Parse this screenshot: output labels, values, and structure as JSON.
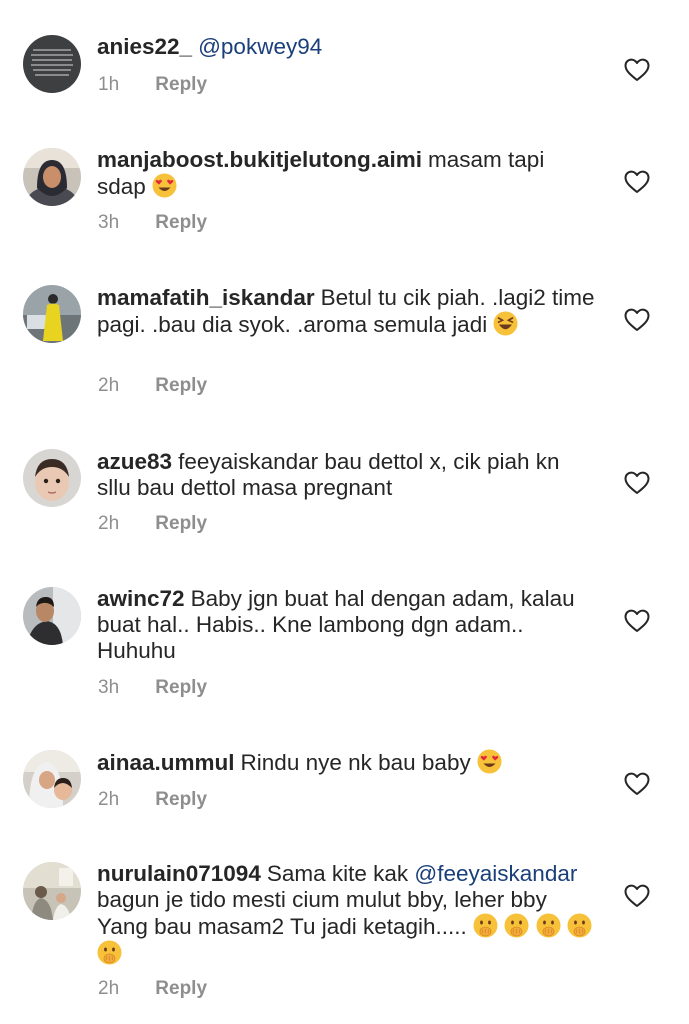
{
  "comments": [
    {
      "username": "anies22_",
      "text": "@pokwey94",
      "time": "1h",
      "reply_label": "Reply",
      "avatar_icon": "dark-text-image-avatar",
      "like_icon": "heart-outline-icon"
    },
    {
      "username": "manjaboost.bukitjelutong.aimi",
      "text": "masam tapi sdap",
      "emoji": "heart-eyes-emoji",
      "time": "3h",
      "reply_label": "Reply",
      "avatar_icon": "woman-hijab-avatar",
      "like_icon": "heart-outline-icon"
    },
    {
      "username": "mamafatih_iskandar",
      "text": "Betul tu cik piah. .lagi2 time pagi. .bau dia syok. .aroma semula jadi",
      "emoji": "laughing-squint-emoji",
      "time": "2h",
      "reply_label": "Reply",
      "avatar_icon": "woman-yellow-dress-avatar",
      "like_icon": "heart-outline-icon"
    },
    {
      "username": "azue83",
      "text": "feeyaiskandar bau dettol x, cik piah kn sllu bau dettol masa pregnant",
      "time": "2h",
      "reply_label": "Reply",
      "avatar_icon": "baby-face-avatar",
      "like_icon": "heart-outline-icon"
    },
    {
      "username": "awinc72",
      "text": "Baby jgn buat hal dengan adam, kalau buat hal.. Habis.. Kne lambong dgn adam.. Huhuhu",
      "time": "3h",
      "reply_label": "Reply",
      "avatar_icon": "man-in-car-avatar",
      "like_icon": "heart-outline-icon"
    },
    {
      "username": "ainaa.ummul",
      "text": "Rindu nye nk bau baby",
      "emoji": "heart-eyes-emoji",
      "time": "2h",
      "reply_label": "Reply",
      "avatar_icon": "mother-and-baby-avatar",
      "like_icon": "heart-outline-icon"
    },
    {
      "username": "nurulain071094",
      "text_before": "Sama kite kak",
      "mention": "@feeyaiskandar",
      "text_after": "bagun je tido mesti cium mulut bby, leher bby Yang bau masam2 Tu jadi ketagih.....",
      "emoji": "hand-over-mouth-emoji",
      "time": "2h",
      "reply_label": "Reply",
      "avatar_icon": "family-room-avatar",
      "like_icon": "heart-outline-icon"
    }
  ]
}
